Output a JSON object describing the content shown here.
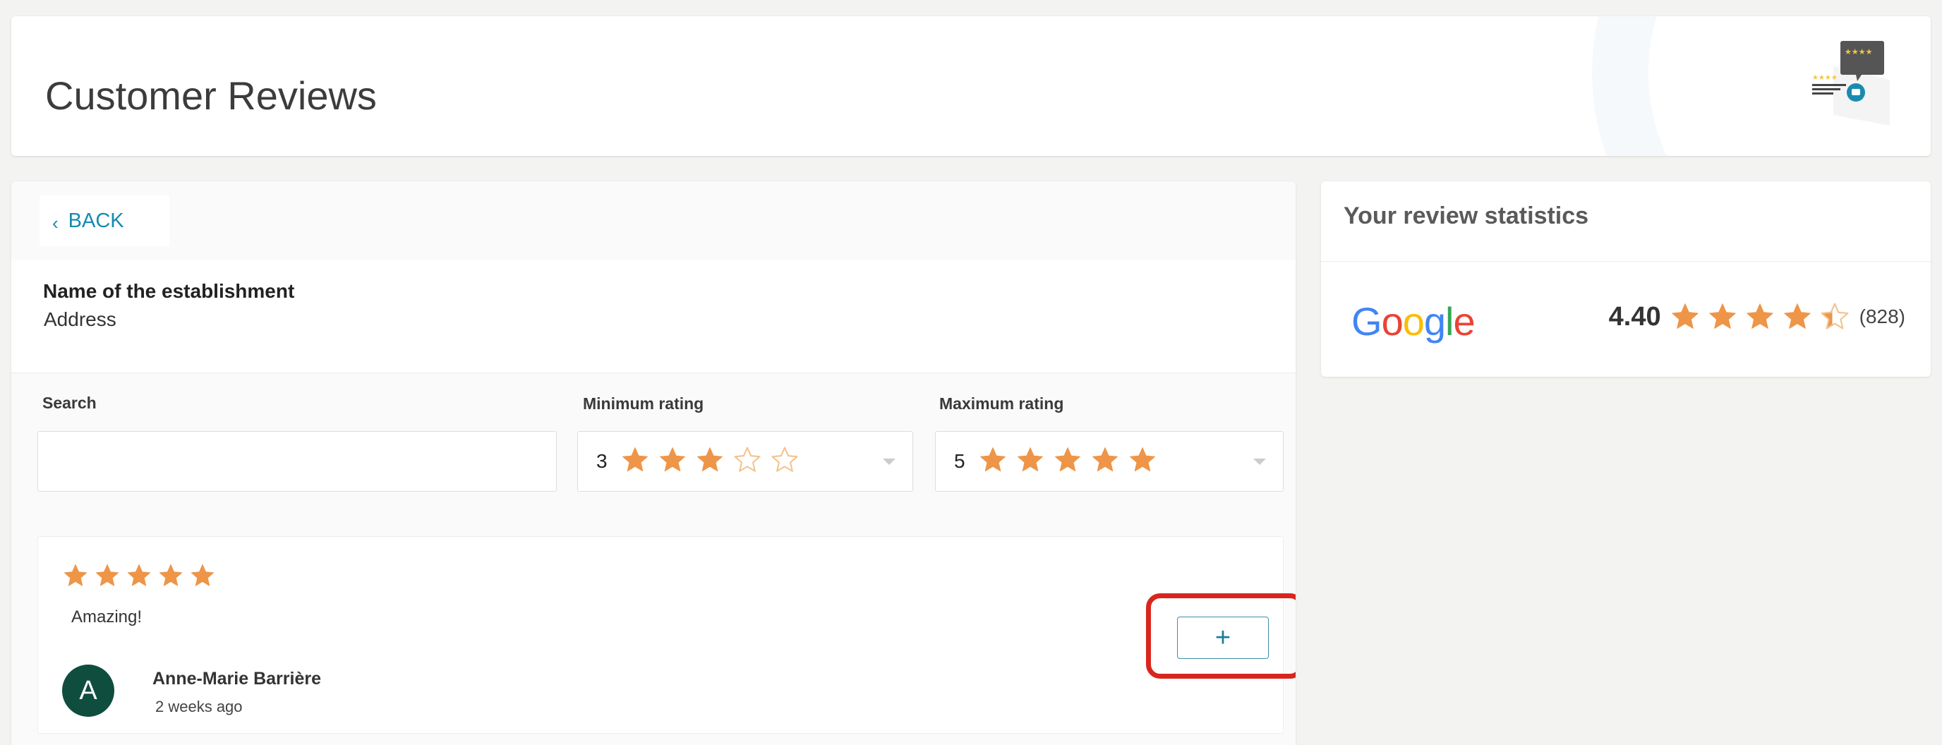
{
  "header": {
    "title": "Customer Reviews",
    "icon": "review-speech-icon"
  },
  "back": {
    "label": "BACK",
    "icon": "chevron-left-icon"
  },
  "establishment": {
    "name": "Name of the establishment",
    "address": "Address"
  },
  "filters": {
    "search_label": "Search",
    "search_value": "",
    "min_label": "Minimum rating",
    "min_value": "3",
    "min_stars": 3,
    "max_label": "Maximum rating",
    "max_value": "5",
    "max_stars": 5
  },
  "review": {
    "rating": 5,
    "text": "Amazing!",
    "avatar_letter": "A",
    "author": "Anne-Marie Barrière",
    "time": "2 weeks ago",
    "action_label": "+"
  },
  "stats": {
    "title": "Your review statistics",
    "source": "Google",
    "average": "4.40",
    "average_value": 4.4,
    "count": "(828)"
  },
  "colors": {
    "accent": "#168ab0",
    "star": "#ee9548",
    "highlight": "#d8261e",
    "avatar": "#0f4d3f"
  }
}
